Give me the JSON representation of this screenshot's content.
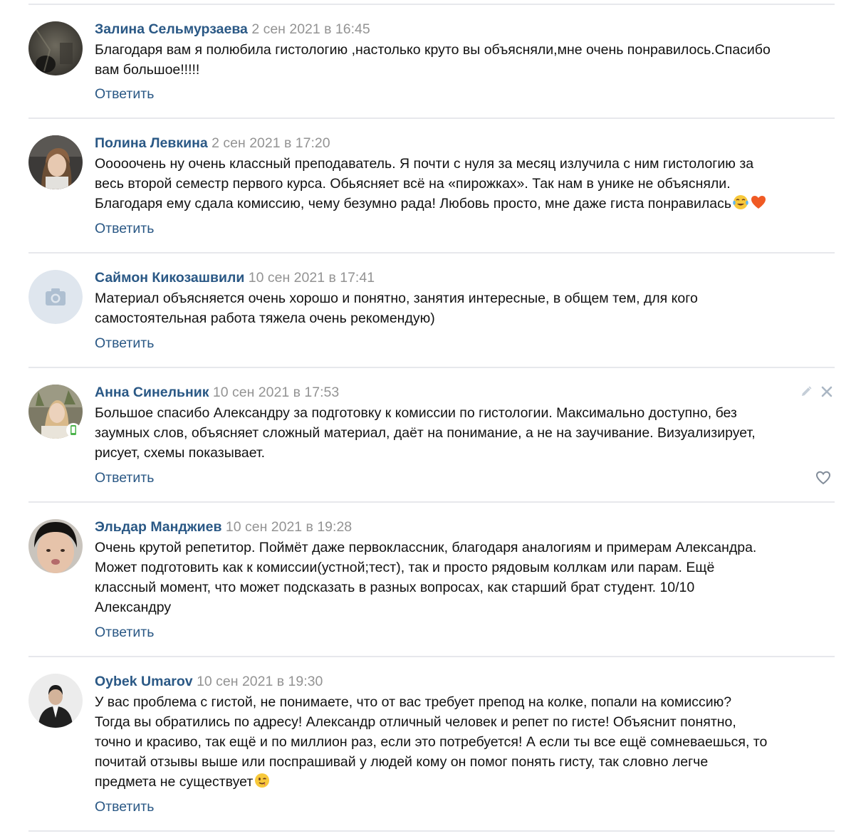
{
  "reply_label": "Ответить",
  "colors": {
    "author": "#2a5885",
    "date": "#939393",
    "text": "#111111",
    "separator": "#e7e8ec",
    "online_mobile": "#4bb34b"
  },
  "comments": [
    {
      "author": "Залина Сельмурзаева",
      "date": "2 сен 2021 в 16:45",
      "text": "Благодаря вам я полюбила гистологию ,настолько круто вы объясняли,мне очень понравилось.Спасибо\nвам большое!!!!!",
      "avatar": "photo"
    },
    {
      "author": "Полина Левкина",
      "date": "2 сен 2021 в 17:20",
      "text": "Ооооочень ну очень классный преподаватель. Я почти с нуля за месяц излучила с ним гистологию за\nвесь второй семестр первого курса. Обьясняет всё на «пирожках». Так нам в унике не объясняли.\nБлагодаря ему сдала комиссию, чему безумно рада! Любовь просто, мне даже гиста понравилась",
      "emoji_tail": [
        "joy-tears-emoji",
        "heart-emoji"
      ],
      "avatar": "photo"
    },
    {
      "author": "Саймон Кикозашвили",
      "date": "10 сен 2021 в 17:41",
      "text": "Материал объясняется очень хорошо и понятно, занятия интересные, в общем тем, для кого\nсамостоятельная работа тяжела очень рекомендую)",
      "avatar": "camera-placeholder-icon"
    },
    {
      "author": "Анна Синельник",
      "date": "10 сен 2021 в 17:53",
      "text": "Большое спасибо Александру за подготовку к комиссии по гистологии. Максимально доступно, без\nзаумных слов, объясняет сложный материал, даёт на понимание, а не на заучивание. Визуализирует,\nрисует, схемы показывает.",
      "avatar": "photo",
      "online_mobile": true,
      "actions": [
        "pencil-icon",
        "close-icon",
        "heart-outline-icon"
      ]
    },
    {
      "author": "Эльдар Манджиев",
      "date": "10 сен 2021 в 19:28",
      "text": "Очень крутой репетитор. Поймёт даже первоклассник, благодаря аналогиям и примерам Александра.\nМожет подготовить как к комиссии(устной;тест), так и просто рядовым коллкам или парам. Ещё\nклассный момент, что может подсказать в разных вопросах, как старший брат студент. 10/10\nАлександру",
      "avatar": "photo"
    },
    {
      "author": "Oybek Umarov",
      "date": "10 сен 2021 в 19:30",
      "text": "У вас проблема с гистой, не понимаете, что от вас требует препод на колке, попали на комиссию?\nТогда вы обратились по адресу! Александр отличный человек и репет по гисте! Объяснит понятно,\nточно и красиво, так ещё и по миллион раз, если это потребуется! А если ты все ещё сомневаешься, то\nпочитай отзывы выше или поспрашивай у людей кому он помог понять гисту, так словно легче\nпредмета не существует",
      "emoji_tail": [
        "wink-emoji"
      ],
      "avatar": "photo"
    }
  ]
}
